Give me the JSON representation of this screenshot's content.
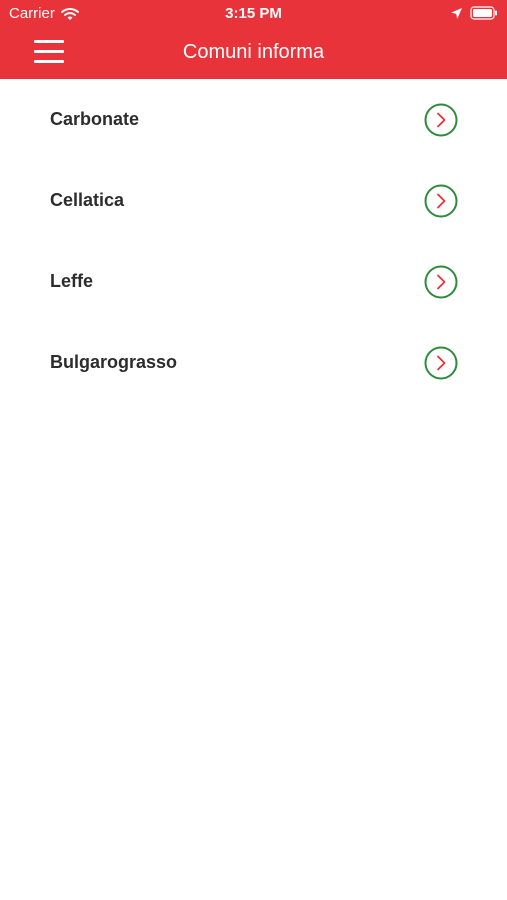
{
  "status_bar": {
    "carrier": "Carrier",
    "time": "3:15 PM",
    "icons": [
      "wifi-icon",
      "location-arrow-icon",
      "battery-icon"
    ]
  },
  "nav_bar": {
    "title": "Comuni informa",
    "menu_icon": "hamburger-menu-icon"
  },
  "list": {
    "items": [
      {
        "label": "Carbonate"
      },
      {
        "label": "Cellatica"
      },
      {
        "label": "Leffe"
      },
      {
        "label": "Bulgarograsso"
      }
    ],
    "arrow_icon": "chevron-right-circle-icon"
  },
  "colors": {
    "header_background": "#e8333b",
    "header_text": "#ffffff",
    "item_text": "#2d2d2d",
    "arrow_circle": "#2e8b3a",
    "arrow_chevron": "#e8333b",
    "background": "#ffffff"
  }
}
